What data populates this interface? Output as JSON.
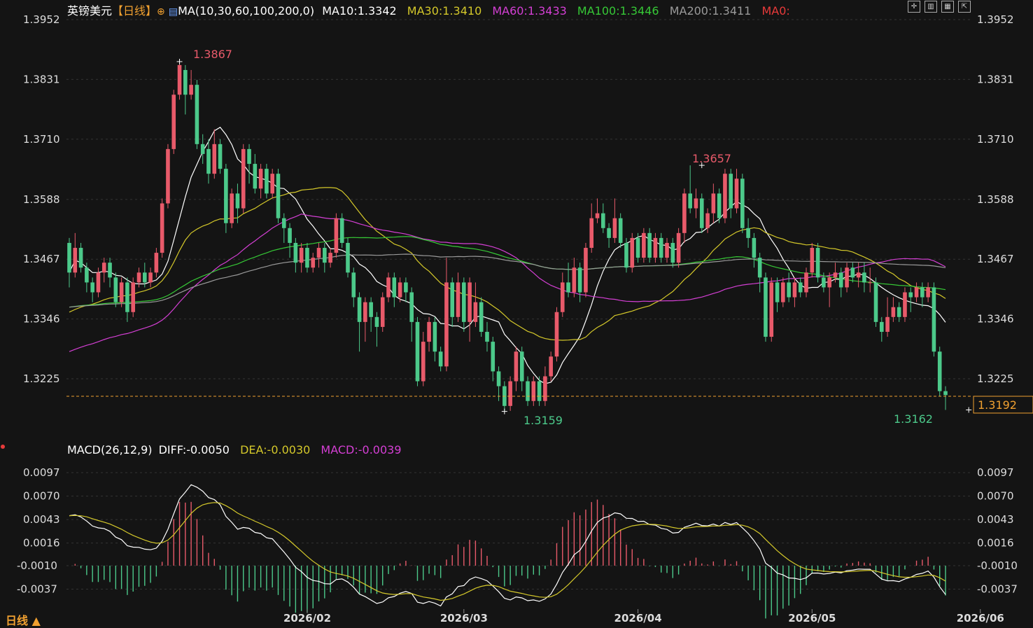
{
  "header": {
    "symbol": "英镑美元",
    "period_tag": "【日线】",
    "ma_params": "MA(10,30,60,100,200,0)",
    "ma10": "MA10:1.3342",
    "ma30": "MA30:1.3410",
    "ma60": "MA60:1.3433",
    "ma100": "MA100:1.3446",
    "ma200": "MA200:1.3411",
    "ma0": "MA0:"
  },
  "macd_header": {
    "params": "MACD(26,12,9)",
    "diff": "DIFF:-0.0050",
    "dea": "DEA:-0.0030",
    "macd": "MACD:-0.0039"
  },
  "footer": {
    "period_label": "日线 ▲"
  },
  "colors": {
    "up": "#e85a6a",
    "down": "#4cc98a",
    "ma10": "#ffffff",
    "ma30": "#d4c82a",
    "ma60": "#d43fd4",
    "ma100": "#36c836",
    "ma200": "#9a9a9a",
    "ma0_text": "#e83a3a",
    "price_line": "#f0a030",
    "background": "#141414"
  },
  "chart_data": [
    {
      "type": "candlestick",
      "title": "英镑美元【日线】",
      "yticks": [
        "1.3952",
        "1.3831",
        "1.3710",
        "1.3588",
        "1.3467",
        "1.3346",
        "1.3225"
      ],
      "ylim": [
        1.314,
        1.3952
      ],
      "xticks": [
        "2026/02",
        "2026/03",
        "2026/04",
        "2026/05",
        "2026/06"
      ],
      "annotations": {
        "high1": "1.3867",
        "high2": "1.3657",
        "low1": "1.3159",
        "low2": "1.3162"
      },
      "last_price": "1.3192",
      "candles": [
        [
          1.35,
          1.344,
          1.351,
          1.341
        ],
        [
          1.344,
          1.349,
          1.352,
          1.343
        ],
        [
          1.349,
          1.345,
          1.35,
          1.344
        ],
        [
          1.345,
          1.342,
          1.346,
          1.34
        ],
        [
          1.342,
          1.34,
          1.343,
          1.338
        ],
        [
          1.34,
          1.344,
          1.345,
          1.339
        ],
        [
          1.344,
          1.346,
          1.347,
          1.342
        ],
        [
          1.346,
          1.343,
          1.347,
          1.341
        ],
        [
          1.343,
          1.338,
          1.344,
          1.337
        ],
        [
          1.338,
          1.342,
          1.343,
          1.337
        ],
        [
          1.342,
          1.336,
          1.343,
          1.334
        ],
        [
          1.336,
          1.342,
          1.343,
          1.335
        ],
        [
          1.342,
          1.344,
          1.345,
          1.341
        ],
        [
          1.344,
          1.342,
          1.346,
          1.341
        ],
        [
          1.342,
          1.344,
          1.345,
          1.341
        ],
        [
          1.344,
          1.348,
          1.349,
          1.343
        ],
        [
          1.348,
          1.358,
          1.359,
          1.347
        ],
        [
          1.358,
          1.369,
          1.37,
          1.357
        ],
        [
          1.369,
          1.38,
          1.381,
          1.368
        ],
        [
          1.38,
          1.386,
          1.3867,
          1.379
        ],
        [
          1.385,
          1.38,
          1.386,
          1.376
        ],
        [
          1.38,
          1.382,
          1.385,
          1.379
        ],
        [
          1.382,
          1.37,
          1.383,
          1.369
        ],
        [
          1.37,
          1.368,
          1.372,
          1.366
        ],
        [
          1.369,
          1.364,
          1.371,
          1.362
        ],
        [
          1.364,
          1.37,
          1.373,
          1.363
        ],
        [
          1.37,
          1.365,
          1.371,
          1.364
        ],
        [
          1.365,
          1.354,
          1.366,
          1.352
        ],
        [
          1.354,
          1.36,
          1.361,
          1.353
        ],
        [
          1.36,
          1.357,
          1.362,
          1.354
        ],
        [
          1.357,
          1.369,
          1.37,
          1.356
        ],
        [
          1.369,
          1.366,
          1.37,
          1.362
        ],
        [
          1.366,
          1.361,
          1.368,
          1.36
        ],
        [
          1.361,
          1.365,
          1.366,
          1.359
        ],
        [
          1.365,
          1.36,
          1.366,
          1.359
        ],
        [
          1.36,
          1.364,
          1.365,
          1.359
        ],
        [
          1.364,
          1.355,
          1.365,
          1.354
        ],
        [
          1.355,
          1.353,
          1.356,
          1.35
        ],
        [
          1.353,
          1.35,
          1.354,
          1.347
        ],
        [
          1.35,
          1.346,
          1.351,
          1.344
        ],
        [
          1.346,
          1.349,
          1.35,
          1.344
        ],
        [
          1.349,
          1.345,
          1.35,
          1.344
        ],
        [
          1.345,
          1.347,
          1.348,
          1.344
        ],
        [
          1.347,
          1.349,
          1.35,
          1.345
        ],
        [
          1.349,
          1.346,
          1.35,
          1.344
        ],
        [
          1.346,
          1.348,
          1.349,
          1.345
        ],
        [
          1.348,
          1.355,
          1.356,
          1.347
        ],
        [
          1.355,
          1.35,
          1.356,
          1.349
        ],
        [
          1.35,
          1.344,
          1.351,
          1.343
        ],
        [
          1.344,
          1.339,
          1.345,
          1.337
        ],
        [
          1.339,
          1.334,
          1.34,
          1.328
        ],
        [
          1.334,
          1.338,
          1.339,
          1.33
        ],
        [
          1.338,
          1.335,
          1.339,
          1.332
        ],
        [
          1.335,
          1.333,
          1.336,
          1.329
        ],
        [
          1.333,
          1.339,
          1.34,
          1.332
        ],
        [
          1.339,
          1.343,
          1.344,
          1.338
        ],
        [
          1.343,
          1.339,
          1.344,
          1.337
        ],
        [
          1.339,
          1.342,
          1.343,
          1.338
        ],
        [
          1.342,
          1.34,
          1.343,
          1.338
        ],
        [
          1.34,
          1.334,
          1.341,
          1.33
        ],
        [
          1.334,
          1.322,
          1.335,
          1.321
        ],
        [
          1.322,
          1.33,
          1.332,
          1.321
        ],
        [
          1.33,
          1.334,
          1.335,
          1.328
        ],
        [
          1.334,
          1.328,
          1.335,
          1.326
        ],
        [
          1.328,
          1.325,
          1.329,
          1.324
        ],
        [
          1.325,
          1.342,
          1.347,
          1.324
        ],
        [
          1.342,
          1.335,
          1.343,
          1.333
        ],
        [
          1.335,
          1.342,
          1.344,
          1.334
        ],
        [
          1.342,
          1.334,
          1.343,
          1.332
        ],
        [
          1.334,
          1.342,
          1.343,
          1.33
        ],
        [
          1.334,
          1.338,
          1.342,
          1.333
        ],
        [
          1.338,
          1.332,
          1.339,
          1.331
        ],
        [
          1.332,
          1.33,
          1.334,
          1.328
        ],
        [
          1.33,
          1.324,
          1.331,
          1.322
        ],
        [
          1.324,
          1.321,
          1.325,
          1.318
        ],
        [
          1.321,
          1.317,
          1.322,
          1.3159
        ],
        [
          1.317,
          1.322,
          1.323,
          1.316
        ],
        [
          1.322,
          1.328,
          1.329,
          1.32
        ],
        [
          1.328,
          1.322,
          1.329,
          1.32
        ],
        [
          1.322,
          1.318,
          1.323,
          1.317
        ],
        [
          1.318,
          1.322,
          1.323,
          1.317
        ],
        [
          1.322,
          1.318,
          1.323,
          1.317
        ],
        [
          1.318,
          1.323,
          1.325,
          1.317
        ],
        [
          1.323,
          1.327,
          1.328,
          1.322
        ],
        [
          1.327,
          1.336,
          1.337,
          1.326
        ],
        [
          1.336,
          1.342,
          1.344,
          1.335
        ],
        [
          1.342,
          1.34,
          1.346,
          1.339
        ],
        [
          1.34,
          1.345,
          1.347,
          1.339
        ],
        [
          1.345,
          1.34,
          1.346,
          1.338
        ],
        [
          1.34,
          1.349,
          1.35,
          1.339
        ],
        [
          1.349,
          1.355,
          1.358,
          1.348
        ],
        [
          1.355,
          1.356,
          1.359,
          1.354
        ],
        [
          1.356,
          1.353,
          1.358,
          1.352
        ],
        [
          1.353,
          1.351,
          1.354,
          1.349
        ],
        [
          1.351,
          1.355,
          1.359,
          1.35
        ],
        [
          1.355,
          1.35,
          1.356,
          1.349
        ],
        [
          1.35,
          1.345,
          1.351,
          1.344
        ],
        [
          1.345,
          1.351,
          1.352,
          1.344
        ],
        [
          1.351,
          1.347,
          1.352,
          1.346
        ],
        [
          1.347,
          1.352,
          1.353,
          1.346
        ],
        [
          1.352,
          1.347,
          1.353,
          1.346
        ],
        [
          1.347,
          1.351,
          1.352,
          1.346
        ],
        [
          1.351,
          1.347,
          1.352,
          1.346
        ],
        [
          1.347,
          1.35,
          1.351,
          1.346
        ],
        [
          1.35,
          1.346,
          1.351,
          1.345
        ],
        [
          1.346,
          1.352,
          1.353,
          1.345
        ],
        [
          1.352,
          1.36,
          1.361,
          1.35
        ],
        [
          1.36,
          1.357,
          1.3657,
          1.356
        ],
        [
          1.357,
          1.359,
          1.361,
          1.355
        ],
        [
          1.359,
          1.353,
          1.36,
          1.352
        ],
        [
          1.353,
          1.356,
          1.357,
          1.352
        ],
        [
          1.356,
          1.36,
          1.362,
          1.354
        ],
        [
          1.36,
          1.355,
          1.361,
          1.354
        ],
        [
          1.355,
          1.364,
          1.365,
          1.354
        ],
        [
          1.364,
          1.357,
          1.365,
          1.355
        ],
        [
          1.357,
          1.363,
          1.365,
          1.356
        ],
        [
          1.363,
          1.353,
          1.364,
          1.352
        ],
        [
          1.353,
          1.351,
          1.355,
          1.349
        ],
        [
          1.351,
          1.347,
          1.352,
          1.345
        ],
        [
          1.347,
          1.343,
          1.348,
          1.34
        ],
        [
          1.343,
          1.331,
          1.344,
          1.33
        ],
        [
          1.331,
          1.342,
          1.343,
          1.33
        ],
        [
          1.342,
          1.338,
          1.343,
          1.336
        ],
        [
          1.338,
          1.342,
          1.343,
          1.337
        ],
        [
          1.342,
          1.339,
          1.344,
          1.338
        ],
        [
          1.339,
          1.342,
          1.343,
          1.337
        ],
        [
          1.342,
          1.34,
          1.343,
          1.339
        ],
        [
          1.34,
          1.344,
          1.345,
          1.339
        ],
        [
          1.344,
          1.349,
          1.35,
          1.343
        ],
        [
          1.349,
          1.343,
          1.35,
          1.342
        ],
        [
          1.343,
          1.341,
          1.344,
          1.34
        ],
        [
          1.341,
          1.343,
          1.344,
          1.337
        ],
        [
          1.343,
          1.344,
          1.346,
          1.342
        ],
        [
          1.344,
          1.341,
          1.345,
          1.339
        ],
        [
          1.341,
          1.345,
          1.346,
          1.34
        ],
        [
          1.345,
          1.343,
          1.346,
          1.342
        ],
        [
          1.343,
          1.344,
          1.346,
          1.341
        ],
        [
          1.344,
          1.342,
          1.346,
          1.34
        ],
        [
          1.342,
          1.342,
          1.345,
          1.34
        ],
        [
          1.342,
          1.334,
          1.343,
          1.333
        ],
        [
          1.334,
          1.332,
          1.335,
          1.33
        ],
        [
          1.332,
          1.335,
          1.339,
          1.331
        ],
        [
          1.335,
          1.337,
          1.339,
          1.334
        ],
        [
          1.337,
          1.335,
          1.338,
          1.334
        ],
        [
          1.335,
          1.34,
          1.341,
          1.334
        ],
        [
          1.34,
          1.339,
          1.341,
          1.336
        ],
        [
          1.339,
          1.341,
          1.342,
          1.338
        ],
        [
          1.341,
          1.339,
          1.342,
          1.337
        ],
        [
          1.339,
          1.341,
          1.342,
          1.338
        ],
        [
          1.341,
          1.328,
          1.342,
          1.327
        ],
        [
          1.328,
          1.32,
          1.329,
          1.319
        ],
        [
          1.32,
          1.3192,
          1.321,
          1.3162
        ]
      ]
    },
    {
      "type": "macd",
      "title": "MACD(26,12,9)",
      "yticks": [
        "0.0097",
        "0.0070",
        "0.0043",
        "0.0016",
        "-0.0010",
        "-0.0037"
      ],
      "ylim": [
        -0.006,
        0.011
      ]
    }
  ]
}
